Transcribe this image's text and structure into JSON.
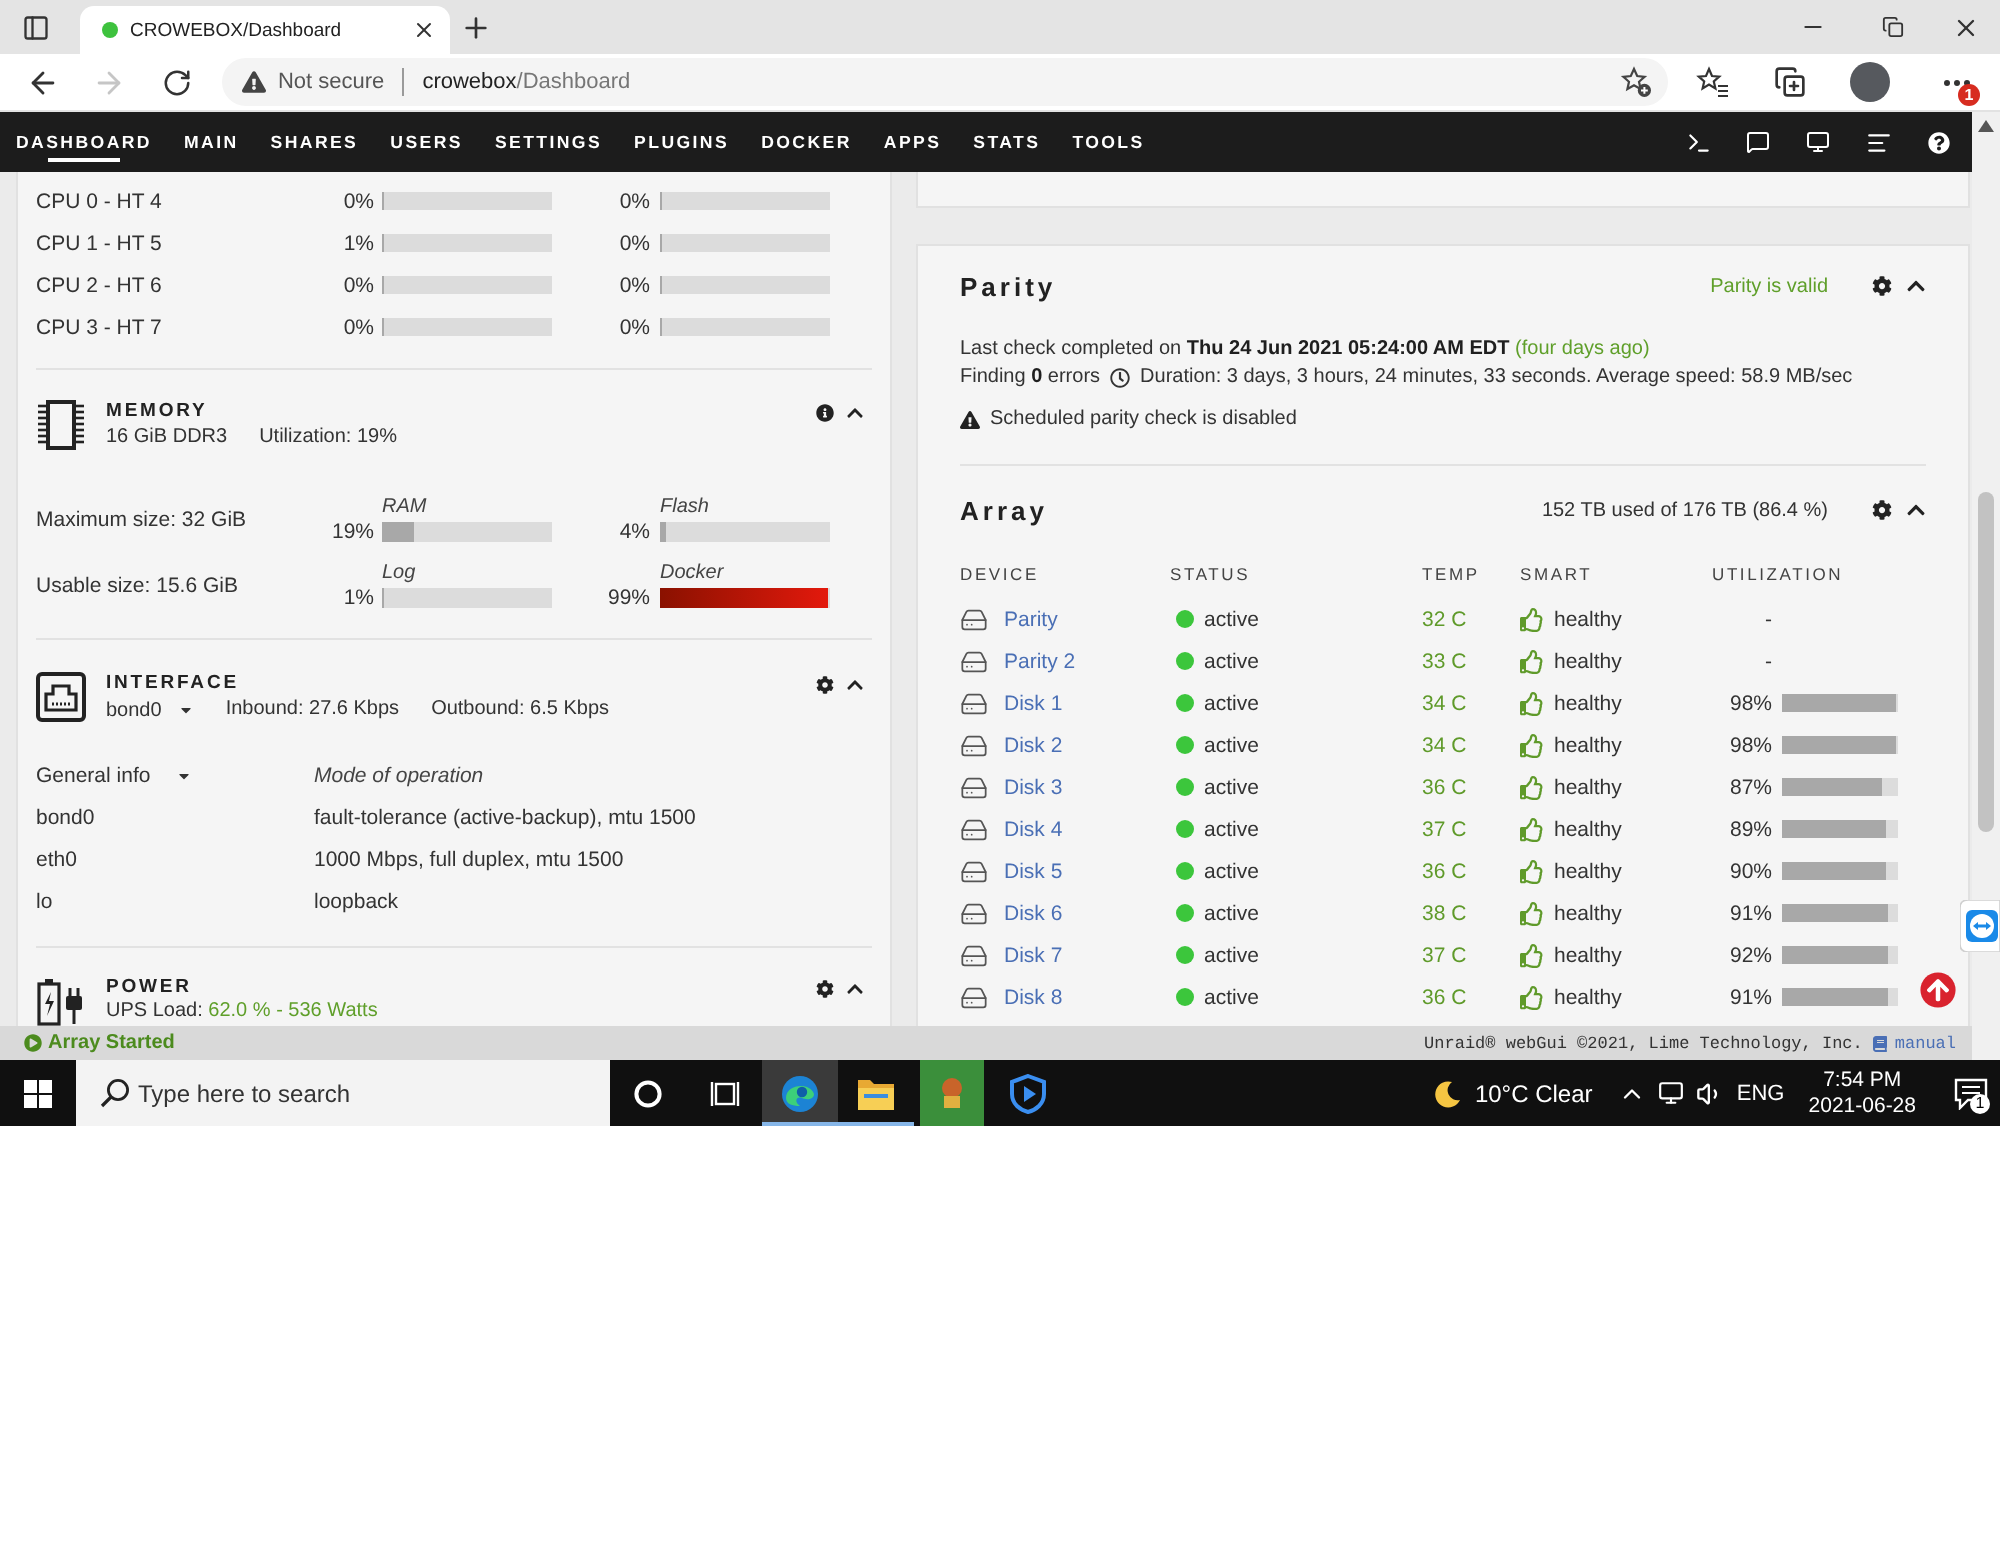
{
  "browser": {
    "tabs": [
      {
        "title": "CROWEBOX/Dashboard",
        "selected": true
      }
    ],
    "history": {
      "back": {
        "disabled": false
      },
      "forward": {
        "disabled": true
      }
    },
    "address": {
      "security": "Not secure",
      "host": "crowebox",
      "path": "/Dashboard"
    },
    "menu_badge": "1"
  },
  "nav": {
    "items": [
      {
        "label": "DASHBOARD",
        "selected": true
      },
      {
        "label": "MAIN",
        "selected": false
      },
      {
        "label": "SHARES",
        "selected": false
      },
      {
        "label": "USERS",
        "selected": false
      },
      {
        "label": "SETTINGS",
        "selected": false
      },
      {
        "label": "PLUGINS",
        "selected": false
      },
      {
        "label": "DOCKER",
        "selected": false
      },
      {
        "label": "APPS",
        "selected": false
      },
      {
        "label": "STATS",
        "selected": false
      },
      {
        "label": "TOOLS",
        "selected": false
      }
    ]
  },
  "processor": {
    "rows": [
      {
        "label": "CPU 0 - HT 4",
        "threads": [
          {
            "reading": "0%",
            "level": 0
          },
          {
            "reading": "0%",
            "level": 0
          }
        ]
      },
      {
        "label": "CPU 1 - HT 5",
        "threads": [
          {
            "reading": "1%",
            "level": 0.01
          },
          {
            "reading": "0%",
            "level": 0
          }
        ]
      },
      {
        "label": "CPU 2 - HT 6",
        "threads": [
          {
            "reading": "0%",
            "level": 0
          },
          {
            "reading": "0%",
            "level": 0
          }
        ]
      },
      {
        "label": "CPU 3 - HT 7",
        "threads": [
          {
            "reading": "0%",
            "level": 0
          },
          {
            "reading": "0%",
            "level": 0
          }
        ]
      }
    ]
  },
  "memory": {
    "title": "MEMORY",
    "installed": "16 GiB DDR3",
    "utilization": "Utilization: 19%",
    "rows": [
      {
        "label": "Maximum size: 32 GiB",
        "meters": [
          {
            "name": "RAM",
            "reading": "19%",
            "level": 0.19,
            "alert": false
          },
          {
            "name": "Flash",
            "reading": "4%",
            "level": 0.04,
            "alert": false
          }
        ]
      },
      {
        "label": "Usable size: 15.6 GiB",
        "meters": [
          {
            "name": "Log",
            "reading": "1%",
            "level": 0.01,
            "alert": false
          },
          {
            "name": "Docker",
            "reading": "99%",
            "level": 0.99,
            "alert": true
          }
        ]
      }
    ]
  },
  "interface": {
    "title": "INTERFACE",
    "port": "bond0",
    "inbound": "Inbound: 27.6 Kbps",
    "outbound": "Outbound: 6.5 Kbps",
    "view": "General info",
    "column": "Mode of operation",
    "rows": [
      {
        "name": "bond0",
        "mode": "fault-tolerance (active-backup), mtu 1500"
      },
      {
        "name": "eth0",
        "mode": "1000 Mbps, full duplex, mtu 1500"
      },
      {
        "name": "lo",
        "mode": "loopback"
      }
    ]
  },
  "power": {
    "title": "POWER",
    "load_label": "UPS Load:",
    "load": "62.0 % - 536 Watts"
  },
  "parity": {
    "title": "Parity",
    "status": "Parity is valid",
    "last_check": "Last check completed on **Thu 24 Jun 2021 05:24:00 AM EDT**",
    "age": "(four days ago)",
    "finding": "Finding **0** errors",
    "duration": "Duration: 3 days, 3 hours, 24 minutes, 33 seconds. Average speed: 58.9 MB/sec",
    "warning": "Scheduled parity check is disabled"
  },
  "array": {
    "title": "Array",
    "usage": "152 TB used of 176 TB (86.4 %)",
    "columns": [
      "DEVICE",
      "STATUS",
      "TEMP",
      "SMART",
      "UTILIZATION"
    ],
    "rows": [
      {
        "device": "Parity",
        "status": "active",
        "temp": "32 C",
        "smart": "healthy",
        "utilization": "-"
      },
      {
        "device": "Parity 2",
        "status": "active",
        "temp": "33 C",
        "smart": "healthy",
        "utilization": "-"
      },
      {
        "device": "Disk 1",
        "status": "active",
        "temp": "34 C",
        "smart": "healthy",
        "utilization": "98%",
        "level": 0.98
      },
      {
        "device": "Disk 2",
        "status": "active",
        "temp": "34 C",
        "smart": "healthy",
        "utilization": "98%",
        "level": 0.98
      },
      {
        "device": "Disk 3",
        "status": "active",
        "temp": "36 C",
        "smart": "healthy",
        "utilization": "87%",
        "level": 0.87
      },
      {
        "device": "Disk 4",
        "status": "active",
        "temp": "37 C",
        "smart": "healthy",
        "utilization": "89%",
        "level": 0.89
      },
      {
        "device": "Disk 5",
        "status": "active",
        "temp": "36 C",
        "smart": "healthy",
        "utilization": "90%",
        "level": 0.9
      },
      {
        "device": "Disk 6",
        "status": "active",
        "temp": "38 C",
        "smart": "healthy",
        "utilization": "91%",
        "level": 0.91
      },
      {
        "device": "Disk 7",
        "status": "active",
        "temp": "37 C",
        "smart": "healthy",
        "utilization": "92%",
        "level": 0.92
      },
      {
        "device": "Disk 8",
        "status": "active",
        "temp": "36 C",
        "smart": "healthy",
        "utilization": "91%",
        "level": 0.91
      }
    ]
  },
  "status_bar": {
    "array_state": "Array Started",
    "copyright": "Unraid® webGui ©2021, Lime Technology, Inc.",
    "manual": "manual"
  },
  "taskbar": {
    "search": {
      "placeholder": "Type here to search"
    },
    "apps": [
      {
        "kind": "edge",
        "selected": true,
        "running": true
      },
      {
        "kind": "files",
        "selected": false,
        "running": true
      },
      {
        "kind": "game",
        "selected": false,
        "running": false
      },
      {
        "kind": "player",
        "selected": false,
        "running": false
      }
    ],
    "weather": "10°C Clear",
    "language": "ENG",
    "time": "7:54 PM",
    "date": "2021-06-28",
    "notifications": "1"
  }
}
